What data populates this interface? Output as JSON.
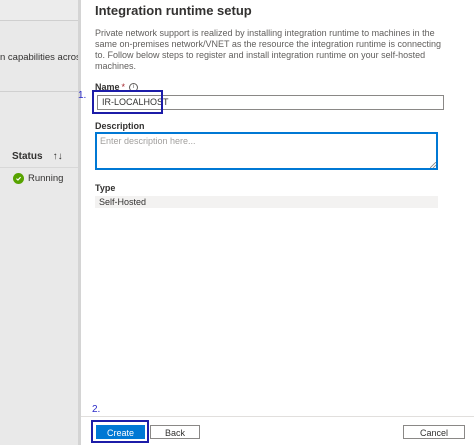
{
  "background": {
    "caption": "n capabilities across di",
    "status_header": "Status",
    "status_value": "Running"
  },
  "panel": {
    "title": "Integration runtime setup",
    "description": "Private network support is realized by installing integration runtime to machines in the same on-premises network/VNET as the resource the integration runtime is connecting to. Follow below steps to register and install integration runtime on your self-hosted machines.",
    "name_label": "Name",
    "required_mark": "*",
    "info_glyph": "i",
    "name_value": "IR-LOCALHOST",
    "description_label": "Description",
    "description_placeholder": "Enter description here...",
    "type_label": "Type",
    "type_value": "Self-Hosted"
  },
  "annotations": {
    "step1": "1.",
    "step2": "2."
  },
  "footer": {
    "create_label": "Create",
    "back_label": "Back",
    "cancel_label": "Cancel"
  },
  "colors": {
    "accent": "#0078d4",
    "annotation": "#1c1ca8",
    "status_ok": "#57a300"
  }
}
